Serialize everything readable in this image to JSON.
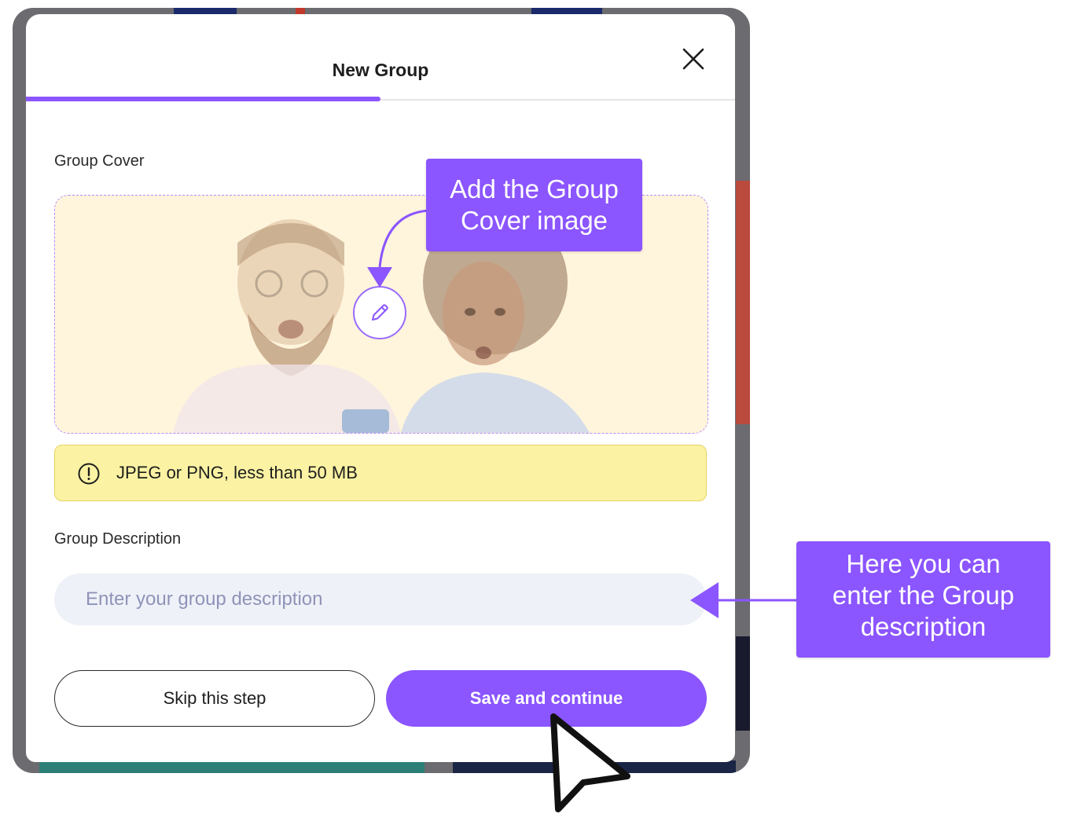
{
  "modal": {
    "title": "New Group",
    "progress": 0.5,
    "cover_label": "Group Cover",
    "notice": "JPEG or PNG, less than 50 MB",
    "description_label": "Group Description",
    "description_placeholder": "Enter your group description",
    "description_value": "",
    "skip_label": "Skip this step",
    "save_label": "Save and continue"
  },
  "callouts": {
    "cover": {
      "line1": "Add the Group",
      "line2": "Cover image"
    },
    "description": {
      "line1": "Here you can",
      "line2": "enter the Group",
      "line3": "description"
    }
  },
  "icons": {
    "close": "close-icon",
    "edit": "pencil-icon",
    "notice": "info-circle-icon",
    "cursor": "mouse-cursor-icon"
  },
  "colors": {
    "accent": "#8b55ff",
    "notice_bg": "#fbf3a3",
    "input_bg": "#eff1f8",
    "cover_bg": "#fff5dc"
  }
}
